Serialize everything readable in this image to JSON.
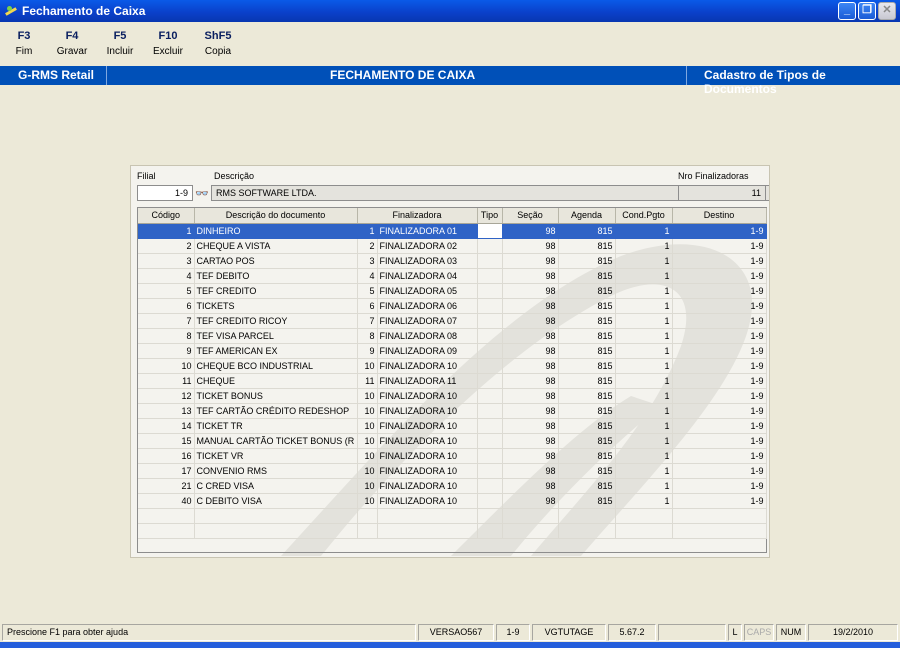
{
  "window": {
    "title": "Fechamento de Caixa",
    "icon": "app-icon"
  },
  "toolbar": [
    {
      "key": "F3",
      "label": "Fim"
    },
    {
      "key": "F4",
      "label": "Gravar"
    },
    {
      "key": "F5",
      "label": "Incluir"
    },
    {
      "key": "F10",
      "label": "Excluir"
    },
    {
      "key": "ShF5",
      "label": "Copia"
    }
  ],
  "band": {
    "left": "G-RMS Retail",
    "center": "FECHAMENTO DE CAIXA",
    "right": "Cadastro de Tipos de Documentos"
  },
  "form": {
    "filial_label": "Filial",
    "filial_value": "1-9",
    "descricao_label": "Descrição",
    "descricao_value": "RMS SOFTWARE LTDA.",
    "nro_label": "Nro Finalizadoras",
    "nro_value": "11",
    "search_icon": "binoculars-icon"
  },
  "table": {
    "columns": [
      "Código",
      "Descrição do documento",
      "Finalizadora",
      "Tipo",
      "Seção",
      "Agenda",
      "Cond.Pgto",
      "Destino"
    ],
    "rows": [
      [
        "1",
        "DINHEIRO",
        "1",
        "FINALIZADORA 01",
        "",
        "98",
        "815",
        "1",
        "1-9"
      ],
      [
        "2",
        "CHEQUE A VISTA",
        "2",
        "FINALIZADORA 02",
        "",
        "98",
        "815",
        "1",
        "1-9"
      ],
      [
        "3",
        "CARTAO POS",
        "3",
        "FINALIZADORA 03",
        "",
        "98",
        "815",
        "1",
        "1-9"
      ],
      [
        "4",
        "TEF DEBITO",
        "4",
        "FINALIZADORA 04",
        "",
        "98",
        "815",
        "1",
        "1-9"
      ],
      [
        "5",
        "TEF CREDITO",
        "5",
        "FINALIZADORA 05",
        "",
        "98",
        "815",
        "1",
        "1-9"
      ],
      [
        "6",
        "TICKETS",
        "6",
        "FINALIZADORA 06",
        "",
        "98",
        "815",
        "1",
        "1-9"
      ],
      [
        "7",
        "TEF CREDITO RICOY",
        "7",
        "FINALIZADORA 07",
        "",
        "98",
        "815",
        "1",
        "1-9"
      ],
      [
        "8",
        "TEF VISA PARCEL",
        "8",
        "FINALIZADORA 08",
        "",
        "98",
        "815",
        "1",
        "1-9"
      ],
      [
        "9",
        "TEF AMERICAN EX",
        "9",
        "FINALIZADORA 09",
        "",
        "98",
        "815",
        "1",
        "1-9"
      ],
      [
        "10",
        "CHEQUE BCO INDUSTRIAL",
        "10",
        "FINALIZADORA 10",
        "",
        "98",
        "815",
        "1",
        "1-9"
      ],
      [
        "11",
        "CHEQUE",
        "11",
        "FINALIZADORA 11",
        "",
        "98",
        "815",
        "1",
        "1-9"
      ],
      [
        "12",
        "TICKET BONUS",
        "10",
        "FINALIZADORA 10",
        "",
        "98",
        "815",
        "1",
        "1-9"
      ],
      [
        "13",
        "TEF CARTÃO CRÉDITO REDESHOP",
        "10",
        "FINALIZADORA 10",
        "",
        "98",
        "815",
        "1",
        "1-9"
      ],
      [
        "14",
        "TICKET TR",
        "10",
        "FINALIZADORA 10",
        "",
        "98",
        "815",
        "1",
        "1-9"
      ],
      [
        "15",
        "MANUAL CARTÃO TICKET BONUS (R",
        "10",
        "FINALIZADORA 10",
        "",
        "98",
        "815",
        "1",
        "1-9"
      ],
      [
        "16",
        "TICKET VR",
        "10",
        "FINALIZADORA 10",
        "",
        "98",
        "815",
        "1",
        "1-9"
      ],
      [
        "17",
        "CONVENIO RMS",
        "10",
        "FINALIZADORA 10",
        "",
        "98",
        "815",
        "1",
        "1-9"
      ],
      [
        "21",
        "C CRED VISA",
        "10",
        "FINALIZADORA 10",
        "",
        "98",
        "815",
        "1",
        "1-9"
      ],
      [
        "40",
        "C DEBITO VISA",
        "10",
        "FINALIZADORA 10",
        "",
        "98",
        "815",
        "1",
        "1-9"
      ]
    ],
    "selected_row": 0
  },
  "status": {
    "help": "Prescione F1 para obter ajuda",
    "version": "VERSAO567",
    "filial": "1-9",
    "user": "VGTUTAGE",
    "build": "5.67.2",
    "l": "L",
    "caps": "CAPS",
    "num": "NUM",
    "date": "19/2/2010"
  },
  "colors": {
    "title": "#0a4fd8",
    "band": "#0050b8",
    "selection": "#2f63c6"
  }
}
